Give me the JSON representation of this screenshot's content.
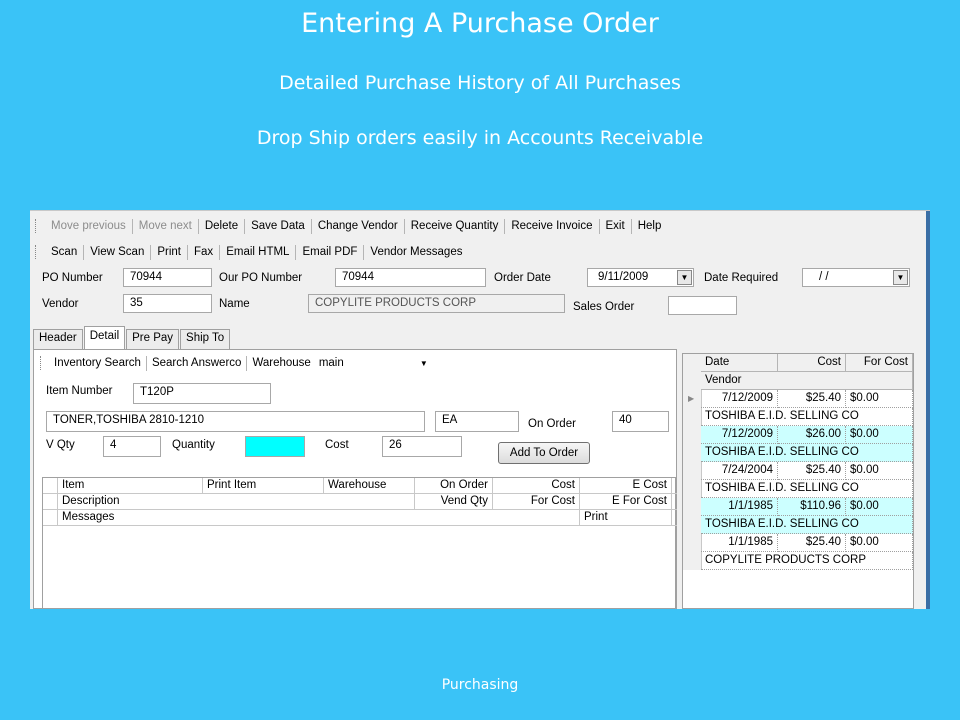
{
  "slide": {
    "title": "Entering  A Purchase Order",
    "subtitle1": "Detailed Purchase History of All Purchases",
    "subtitle2": "Drop Ship orders easily in Accounts Receivable",
    "footer": "Purchasing"
  },
  "toolbar1": {
    "move_previous": "Move previous",
    "move_next": "Move next",
    "delete": "Delete",
    "save_data": "Save Data",
    "change_vendor": "Change Vendor",
    "receive_quantity": "Receive Quantity",
    "receive_invoice": "Receive Invoice",
    "exit": "Exit",
    "help": "Help"
  },
  "toolbar2": {
    "scan": "Scan",
    "view_scan": "View Scan",
    "print": "Print",
    "fax": "Fax",
    "email_html": "Email HTML",
    "email_pdf": "Email PDF",
    "vendor_messages": "Vendor Messages"
  },
  "header_form": {
    "po_number_label": "PO Number",
    "po_number": "70944",
    "our_po_number_label": "Our PO Number",
    "our_po_number": "70944",
    "order_date_label": "Order Date",
    "order_date": "9/11/2009",
    "date_required_label": "Date Required",
    "date_required": "/    /",
    "vendor_label": "Vendor",
    "vendor": "35",
    "name_label": "Name",
    "name": "COPYLITE PRODUCTS CORP",
    "sales_order_label": "Sales Order",
    "sales_order": ""
  },
  "tabs": [
    "Header",
    "Detail",
    "Pre Pay",
    "Ship To"
  ],
  "detail": {
    "inventory_search": "Inventory Search",
    "search_answerco": "Search Answerco",
    "warehouse_label": "Warehouse",
    "warehouse": "main",
    "item_number_label": "Item Number",
    "item_number": "T120P",
    "description": "TONER,TOSHIBA 2810-1210",
    "unit": "EA",
    "on_order_label": "On Order",
    "on_order": "40",
    "vqty_label": "V Qty",
    "vqty": "4",
    "quantity_label": "Quantity",
    "quantity": "",
    "cost_label": "Cost",
    "cost": "26",
    "add_to_order": "Add To Order"
  },
  "grid": {
    "row1": [
      "Item",
      "Print Item",
      "Warehouse",
      "On Order",
      "Cost",
      "E Cost"
    ],
    "row2": [
      "Description",
      "Vend Qty",
      "For Cost",
      "E For Cost"
    ],
    "row3": [
      "Messages",
      "Print"
    ]
  },
  "history": {
    "headers": {
      "date": "Date",
      "cost": "Cost",
      "for_cost": "For Cost",
      "vendor": "Vendor"
    },
    "records": [
      {
        "date": "7/12/2009",
        "cost": "$25.40",
        "for_cost": "$0.00",
        "vendor": "TOSHIBA E.I.D. SELLING CO"
      },
      {
        "date": "7/12/2009",
        "cost": "$26.00",
        "for_cost": "$0.00",
        "vendor": "TOSHIBA E.I.D. SELLING CO"
      },
      {
        "date": "7/24/2004",
        "cost": "$25.40",
        "for_cost": "$0.00",
        "vendor": "TOSHIBA E.I.D. SELLING CO"
      },
      {
        "date": "1/1/1985",
        "cost": "$110.96",
        "for_cost": "$0.00",
        "vendor": "TOSHIBA E.I.D. SELLING CO"
      },
      {
        "date": "1/1/1985",
        "cost": "$25.40",
        "for_cost": "$0.00",
        "vendor": "COPYLITE PRODUCTS CORP"
      }
    ]
  },
  "colors": {
    "slide_background": "#3ac3f7",
    "highlight_row": "#ccffff",
    "quantity_field": "#00ffff"
  }
}
